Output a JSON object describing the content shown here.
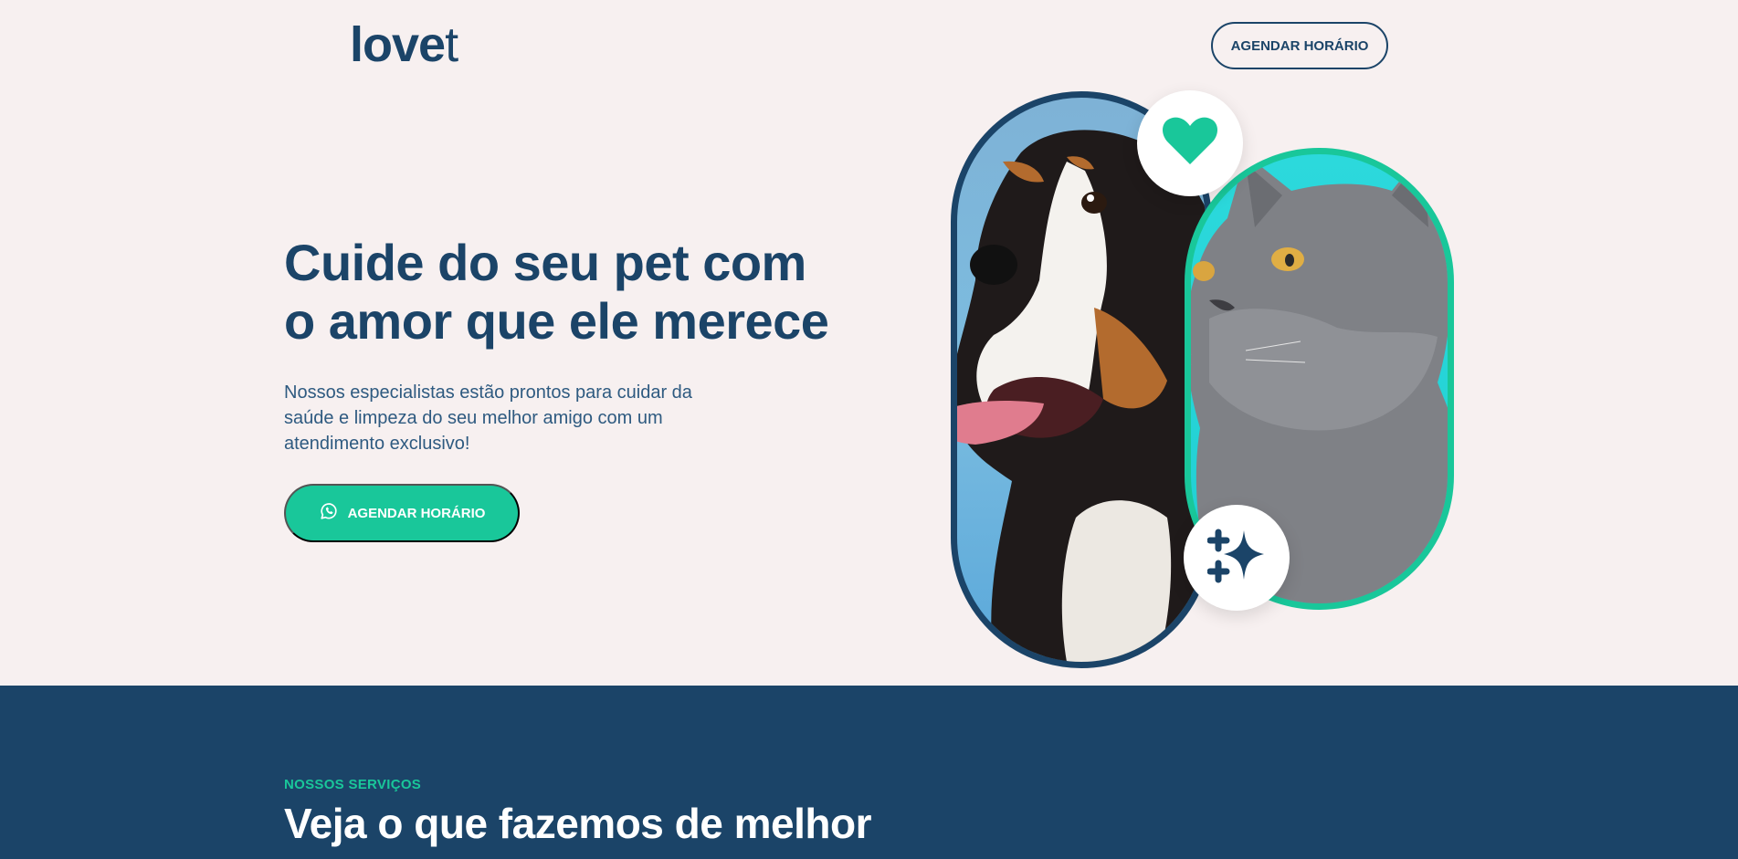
{
  "brand": {
    "logo_bold": "love",
    "logo_thin": "t"
  },
  "header": {
    "cta_label": "AGENDAR HORÁRIO"
  },
  "hero": {
    "title_line1": "Cuide do seu pet com",
    "title_line2": "o amor que ele merece",
    "description": "Nossos especialistas estão prontos para cuidar da saúde e limpeza do seu melhor amigo com um atendimento exclusivo!",
    "cta_label": "AGENDAR HORÁRIO",
    "cta_icon": "whatsapp-icon"
  },
  "badges": {
    "top_icon": "heart-icon",
    "bottom_icon": "sparkle-icon"
  },
  "services": {
    "eyebrow": "NOSSOS SERVIÇOS",
    "title": "Veja o que fazemos de melhor"
  },
  "colors": {
    "navy": "#1b4468",
    "green": "#19c79a",
    "background": "#f7f0f0",
    "cyan": "#22d3d6"
  }
}
